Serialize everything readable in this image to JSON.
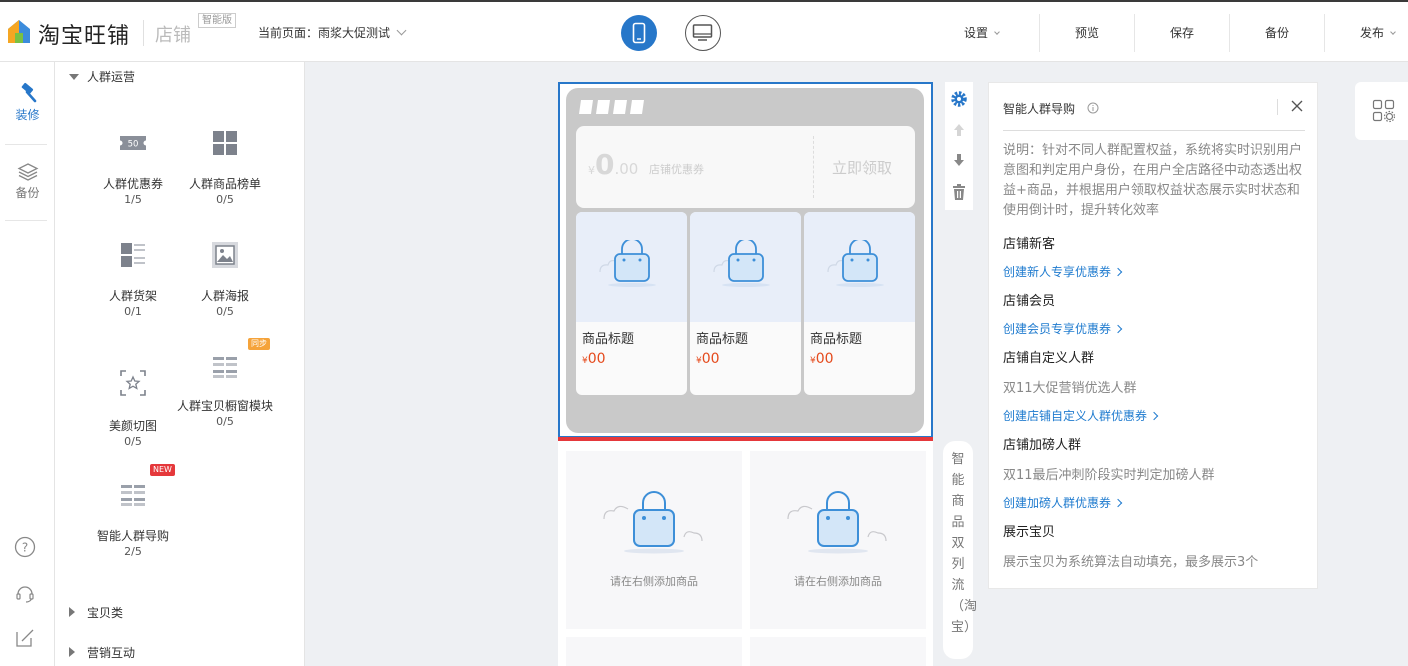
{
  "header": {
    "brand": "淘宝旺铺",
    "brand_sub": "店铺",
    "edition": "智能版",
    "current_page_label": "当前页面：",
    "current_page_value": "雨浆大促测试",
    "nav": {
      "settings": "设置",
      "preview": "预览",
      "save": "保存",
      "backup": "备份",
      "publish": "发布"
    }
  },
  "rail": {
    "decorate": "装修",
    "backup": "备份"
  },
  "panel": {
    "section_crowd": "人群运营",
    "section_goods": "宝贝类",
    "section_marketing": "营销互动",
    "widgets": [
      {
        "name": "人群优惠券",
        "count": "1/5",
        "icon": "coupon-icon",
        "badge": "50"
      },
      {
        "name": "人群商品榜单",
        "count": "0/5",
        "icon": "grid-icon"
      },
      {
        "name": "人群货架",
        "count": "0/1",
        "icon": "shelf-icon"
      },
      {
        "name": "人群海报",
        "count": "0/5",
        "icon": "image-icon"
      },
      {
        "name": "美颜切图",
        "count": "0/5",
        "icon": "crop-star-icon"
      },
      {
        "name": "人群宝贝橱窗模块",
        "count": "0/5",
        "icon": "window-icon",
        "tag": "同步"
      },
      {
        "name": "智能人群导购",
        "count": "2/5",
        "icon": "list-icon",
        "tag": "NEW"
      }
    ]
  },
  "module": {
    "coupon_currency": "¥",
    "coupon_amount": "0",
    "coupon_decimals": ".00",
    "coupon_label": "店铺优惠券",
    "coupon_cta": "立即领取",
    "products": [
      {
        "title": "商品标题",
        "currency": "¥",
        "price": "00"
      },
      {
        "title": "商品标题",
        "currency": "¥",
        "price": "00"
      },
      {
        "title": "商品标题",
        "currency": "¥",
        "price": "00"
      }
    ],
    "empty_tip": "请在右侧添加商品",
    "vertical_label": "智能商品双列流（淘宝）"
  },
  "settings": {
    "title": "智能人群导购",
    "desc": "说明：针对不同人群配置权益，系统将实时识别用户意图和判定用户身份，在用户全店路径中动态透出权益+商品，并根据用户领取权益状态展示实时状态和使用倒计时，提升转化效率",
    "groups": [
      {
        "heading": "店铺新客",
        "text": "",
        "link": "创建新人专享优惠券"
      },
      {
        "heading": "店铺会员",
        "text": "",
        "link": "创建会员专享优惠券"
      },
      {
        "heading": "店铺自定义人群",
        "text": "双11大促营销优选人群",
        "link": "创建店铺自定义人群优惠券"
      },
      {
        "heading": "店铺加磅人群",
        "text": "双11最后冲刺阶段实时判定加磅人群",
        "link": "创建加磅人群优惠券"
      },
      {
        "heading": "展示宝贝",
        "text": "展示宝贝为系统算法自动填充，最多展示3个",
        "link": ""
      }
    ]
  },
  "colors": {
    "accent": "#2777c9",
    "link": "#1f7bcf",
    "price": "#e54a1c",
    "new_tag": "#e5383b",
    "sync_tag": "#f5a33a"
  }
}
